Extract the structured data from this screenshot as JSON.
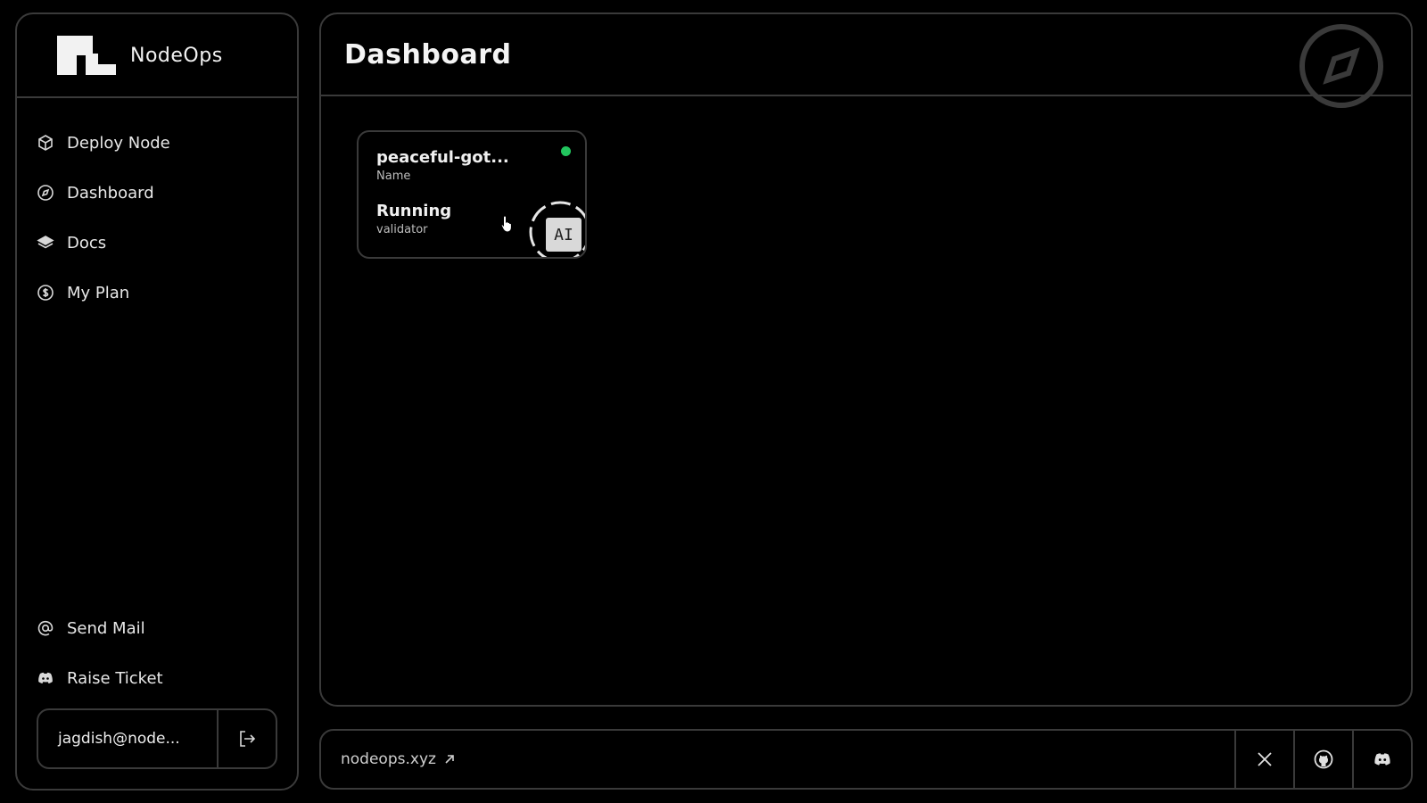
{
  "brand": {
    "name": "NodeOps"
  },
  "nav": {
    "items": [
      {
        "label": "Deploy Node",
        "icon": "cube-icon"
      },
      {
        "label": "Dashboard",
        "icon": "compass-icon"
      },
      {
        "label": "Docs",
        "icon": "layers-icon"
      },
      {
        "label": "My Plan",
        "icon": "dollar-coin-icon"
      }
    ],
    "bottom_items": [
      {
        "label": "Send Mail",
        "icon": "at-icon"
      },
      {
        "label": "Raise Ticket",
        "icon": "discord-icon"
      }
    ]
  },
  "user": {
    "email": "jagdish@node..."
  },
  "header": {
    "title": "Dashboard"
  },
  "node_card": {
    "name_value": "peaceful-got...",
    "name_caption": "Name",
    "status_value": "Running",
    "status_caption": "validator",
    "badge": "AI",
    "status_color": "#22c55e"
  },
  "footer": {
    "link_label": "nodeops.xyz",
    "socials": [
      "x-icon",
      "github-icon",
      "discord-icon"
    ]
  },
  "colors": {
    "background": "#000000",
    "border": "#3a3a3a",
    "status_green": "#22c55e"
  }
}
